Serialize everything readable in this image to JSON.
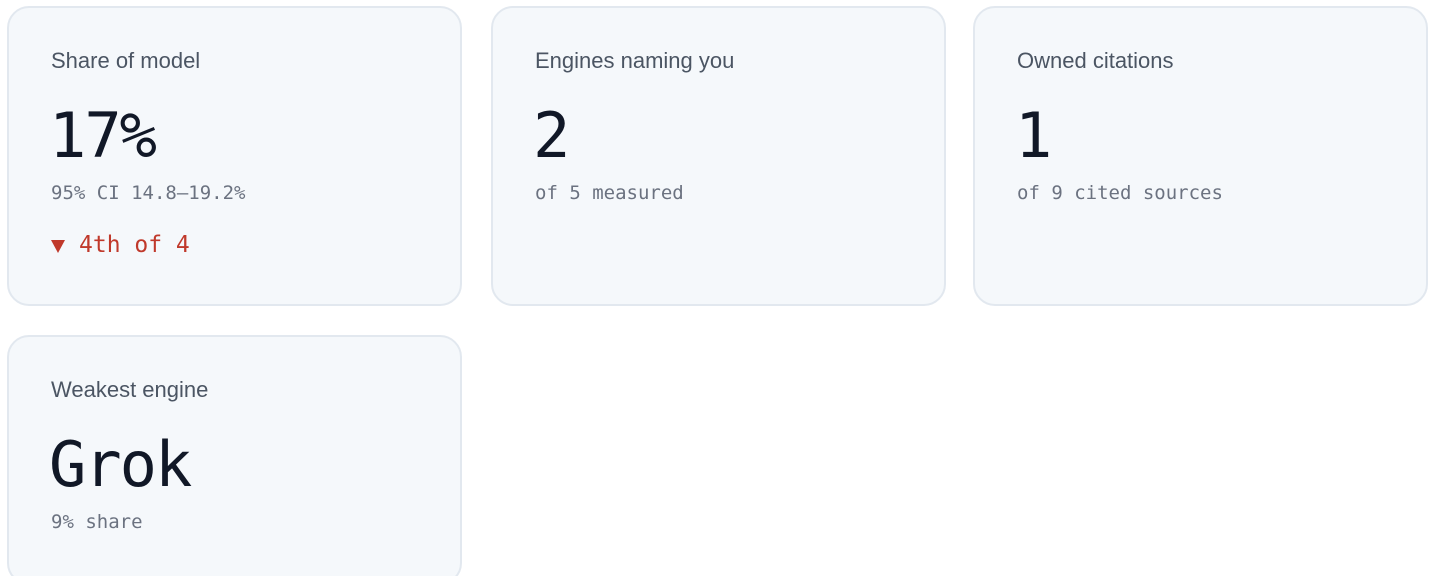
{
  "cards": [
    {
      "label": "Share of model",
      "value": "17%",
      "sub": "95% CI 14.8–19.2%",
      "rank": "4th of 4",
      "rank_direction_icon": "triangle-down-icon",
      "rank_color": "#c0392b"
    },
    {
      "label": "Engines naming you",
      "value": "2",
      "sub": "of 5 measured"
    },
    {
      "label": "Owned citations",
      "value": "1",
      "sub": "of 9 cited sources"
    },
    {
      "label": "Weakest engine",
      "value": "Grok",
      "sub": "9% share"
    }
  ]
}
